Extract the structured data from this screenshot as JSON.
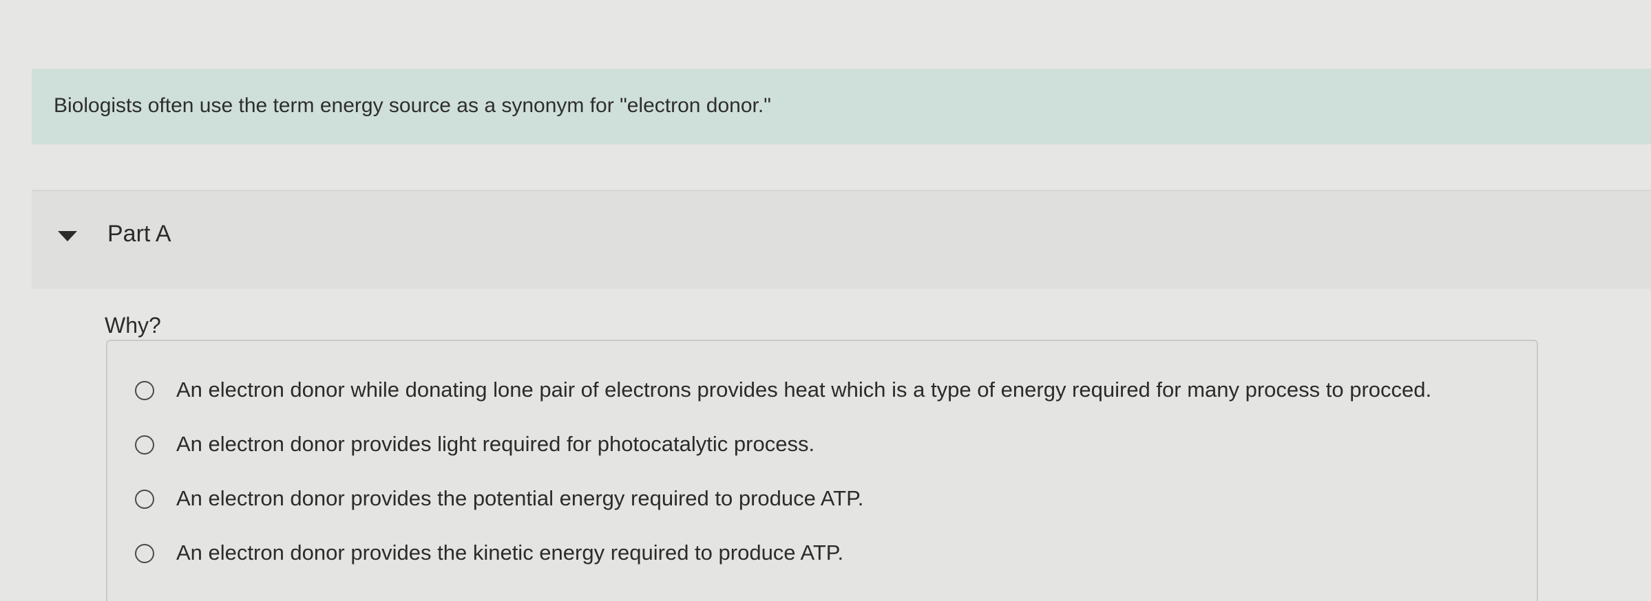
{
  "intro": {
    "text": "Biologists often use the term energy source as a synonym for \"electron donor.\""
  },
  "part": {
    "title": "Part A",
    "caret_icon": "caret-down-icon"
  },
  "question": {
    "prompt": "Why?"
  },
  "options": [
    {
      "label": "An electron donor while donating lone pair of electrons provides heat which is a type of energy required for many process to procced.",
      "selected": false
    },
    {
      "label": "An electron donor provides light required for photocatalytic process.",
      "selected": false
    },
    {
      "label": "An electron donor provides the potential energy required to produce ATP.",
      "selected": false
    },
    {
      "label": "An electron donor provides the kinetic energy required to produce ATP.",
      "selected": false
    }
  ]
}
